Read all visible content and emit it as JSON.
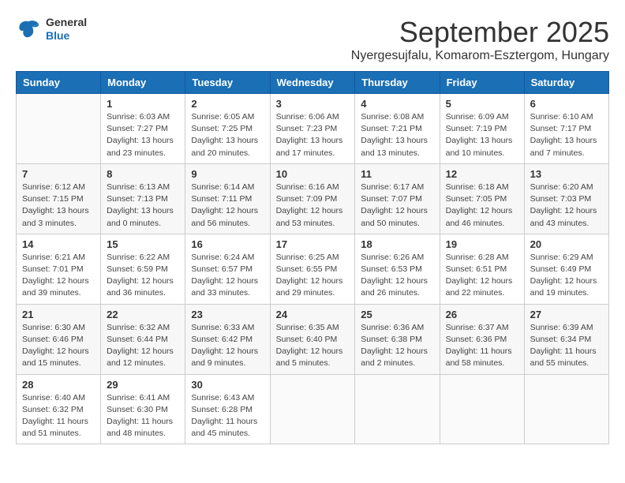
{
  "header": {
    "logo": {
      "general": "General",
      "blue": "Blue"
    },
    "title": "September 2025",
    "location": "Nyergesujfalu, Komarom-Esztergom, Hungary"
  },
  "weekdays": [
    "Sunday",
    "Monday",
    "Tuesday",
    "Wednesday",
    "Thursday",
    "Friday",
    "Saturday"
  ],
  "weeks": [
    [
      {
        "day": "",
        "sunrise": "",
        "sunset": "",
        "daylight": ""
      },
      {
        "day": "1",
        "sunrise": "Sunrise: 6:03 AM",
        "sunset": "Sunset: 7:27 PM",
        "daylight": "Daylight: 13 hours and 23 minutes."
      },
      {
        "day": "2",
        "sunrise": "Sunrise: 6:05 AM",
        "sunset": "Sunset: 7:25 PM",
        "daylight": "Daylight: 13 hours and 20 minutes."
      },
      {
        "day": "3",
        "sunrise": "Sunrise: 6:06 AM",
        "sunset": "Sunset: 7:23 PM",
        "daylight": "Daylight: 13 hours and 17 minutes."
      },
      {
        "day": "4",
        "sunrise": "Sunrise: 6:08 AM",
        "sunset": "Sunset: 7:21 PM",
        "daylight": "Daylight: 13 hours and 13 minutes."
      },
      {
        "day": "5",
        "sunrise": "Sunrise: 6:09 AM",
        "sunset": "Sunset: 7:19 PM",
        "daylight": "Daylight: 13 hours and 10 minutes."
      },
      {
        "day": "6",
        "sunrise": "Sunrise: 6:10 AM",
        "sunset": "Sunset: 7:17 PM",
        "daylight": "Daylight: 13 hours and 7 minutes."
      }
    ],
    [
      {
        "day": "7",
        "sunrise": "Sunrise: 6:12 AM",
        "sunset": "Sunset: 7:15 PM",
        "daylight": "Daylight: 13 hours and 3 minutes."
      },
      {
        "day": "8",
        "sunrise": "Sunrise: 6:13 AM",
        "sunset": "Sunset: 7:13 PM",
        "daylight": "Daylight: 13 hours and 0 minutes."
      },
      {
        "day": "9",
        "sunrise": "Sunrise: 6:14 AM",
        "sunset": "Sunset: 7:11 PM",
        "daylight": "Daylight: 12 hours and 56 minutes."
      },
      {
        "day": "10",
        "sunrise": "Sunrise: 6:16 AM",
        "sunset": "Sunset: 7:09 PM",
        "daylight": "Daylight: 12 hours and 53 minutes."
      },
      {
        "day": "11",
        "sunrise": "Sunrise: 6:17 AM",
        "sunset": "Sunset: 7:07 PM",
        "daylight": "Daylight: 12 hours and 50 minutes."
      },
      {
        "day": "12",
        "sunrise": "Sunrise: 6:18 AM",
        "sunset": "Sunset: 7:05 PM",
        "daylight": "Daylight: 12 hours and 46 minutes."
      },
      {
        "day": "13",
        "sunrise": "Sunrise: 6:20 AM",
        "sunset": "Sunset: 7:03 PM",
        "daylight": "Daylight: 12 hours and 43 minutes."
      }
    ],
    [
      {
        "day": "14",
        "sunrise": "Sunrise: 6:21 AM",
        "sunset": "Sunset: 7:01 PM",
        "daylight": "Daylight: 12 hours and 39 minutes."
      },
      {
        "day": "15",
        "sunrise": "Sunrise: 6:22 AM",
        "sunset": "Sunset: 6:59 PM",
        "daylight": "Daylight: 12 hours and 36 minutes."
      },
      {
        "day": "16",
        "sunrise": "Sunrise: 6:24 AM",
        "sunset": "Sunset: 6:57 PM",
        "daylight": "Daylight: 12 hours and 33 minutes."
      },
      {
        "day": "17",
        "sunrise": "Sunrise: 6:25 AM",
        "sunset": "Sunset: 6:55 PM",
        "daylight": "Daylight: 12 hours and 29 minutes."
      },
      {
        "day": "18",
        "sunrise": "Sunrise: 6:26 AM",
        "sunset": "Sunset: 6:53 PM",
        "daylight": "Daylight: 12 hours and 26 minutes."
      },
      {
        "day": "19",
        "sunrise": "Sunrise: 6:28 AM",
        "sunset": "Sunset: 6:51 PM",
        "daylight": "Daylight: 12 hours and 22 minutes."
      },
      {
        "day": "20",
        "sunrise": "Sunrise: 6:29 AM",
        "sunset": "Sunset: 6:49 PM",
        "daylight": "Daylight: 12 hours and 19 minutes."
      }
    ],
    [
      {
        "day": "21",
        "sunrise": "Sunrise: 6:30 AM",
        "sunset": "Sunset: 6:46 PM",
        "daylight": "Daylight: 12 hours and 15 minutes."
      },
      {
        "day": "22",
        "sunrise": "Sunrise: 6:32 AM",
        "sunset": "Sunset: 6:44 PM",
        "daylight": "Daylight: 12 hours and 12 minutes."
      },
      {
        "day": "23",
        "sunrise": "Sunrise: 6:33 AM",
        "sunset": "Sunset: 6:42 PM",
        "daylight": "Daylight: 12 hours and 9 minutes."
      },
      {
        "day": "24",
        "sunrise": "Sunrise: 6:35 AM",
        "sunset": "Sunset: 6:40 PM",
        "daylight": "Daylight: 12 hours and 5 minutes."
      },
      {
        "day": "25",
        "sunrise": "Sunrise: 6:36 AM",
        "sunset": "Sunset: 6:38 PM",
        "daylight": "Daylight: 12 hours and 2 minutes."
      },
      {
        "day": "26",
        "sunrise": "Sunrise: 6:37 AM",
        "sunset": "Sunset: 6:36 PM",
        "daylight": "Daylight: 11 hours and 58 minutes."
      },
      {
        "day": "27",
        "sunrise": "Sunrise: 6:39 AM",
        "sunset": "Sunset: 6:34 PM",
        "daylight": "Daylight: 11 hours and 55 minutes."
      }
    ],
    [
      {
        "day": "28",
        "sunrise": "Sunrise: 6:40 AM",
        "sunset": "Sunset: 6:32 PM",
        "daylight": "Daylight: 11 hours and 51 minutes."
      },
      {
        "day": "29",
        "sunrise": "Sunrise: 6:41 AM",
        "sunset": "Sunset: 6:30 PM",
        "daylight": "Daylight: 11 hours and 48 minutes."
      },
      {
        "day": "30",
        "sunrise": "Sunrise: 6:43 AM",
        "sunset": "Sunset: 6:28 PM",
        "daylight": "Daylight: 11 hours and 45 minutes."
      },
      {
        "day": "",
        "sunrise": "",
        "sunset": "",
        "daylight": ""
      },
      {
        "day": "",
        "sunrise": "",
        "sunset": "",
        "daylight": ""
      },
      {
        "day": "",
        "sunrise": "",
        "sunset": "",
        "daylight": ""
      },
      {
        "day": "",
        "sunrise": "",
        "sunset": "",
        "daylight": ""
      }
    ]
  ]
}
